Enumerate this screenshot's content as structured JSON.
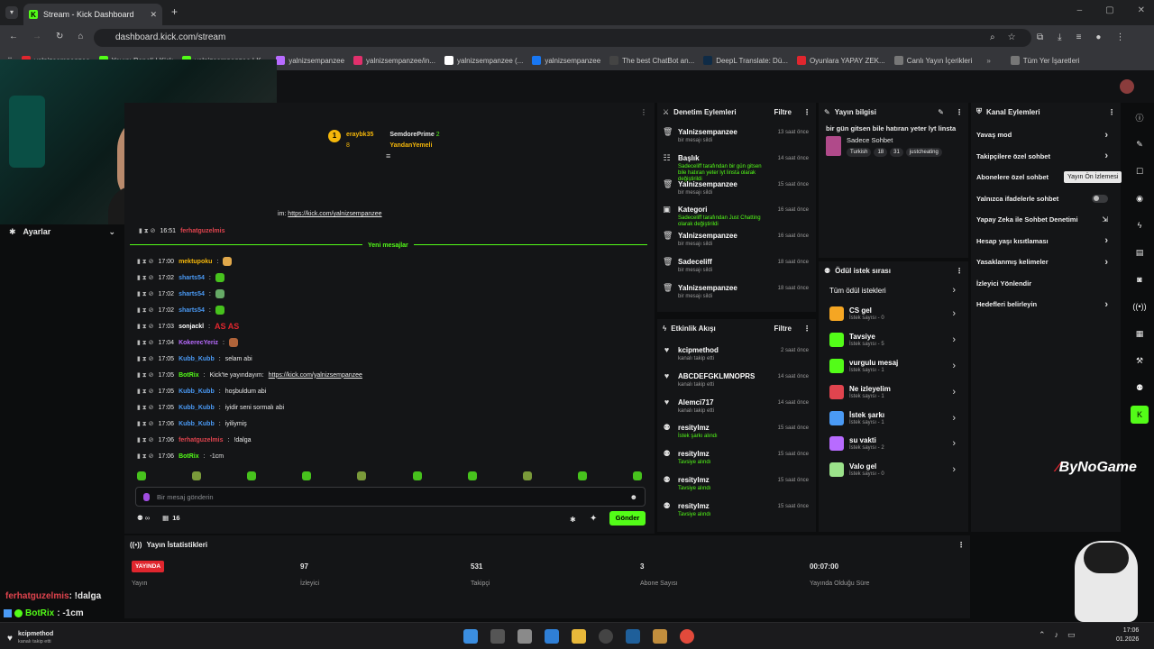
{
  "browser": {
    "tab_title": "Stream - Kick Dashboard",
    "url": "dashboard.kick.com/stream",
    "bookmarks": [
      "yalnizsempanzee",
      "Yayın: Popeli | Kick",
      "yalnizsempanzee | K...",
      "yalnizsempanzee",
      "yalnizsempanzee/in...",
      "yalnizsempanzee (...",
      "yalnizsempanzee",
      "The best ChatBot an...",
      "DeepL Translate: Dü...",
      "Oyunlara YAPAY ZEK...",
      "Canlı Yayın İçerikleri"
    ],
    "all_bookmarks": "Tüm Yer İşaretleri"
  },
  "settings_label": "Ayarlar",
  "chat": {
    "pinned_user1": "eraybk35",
    "pinned_user2": "SemdorePrime",
    "pinned_user3": "YandanYemeli",
    "pinned_count1": "8",
    "pinned_count2": "2",
    "top_link_prefix": "im:",
    "top_link": "https://kick.com/yalnizsempanzee",
    "first_line_time": "16:51",
    "first_line_user": "ferhatguzelmis",
    "new_messages": "Yeni mesajlar",
    "lines": [
      {
        "time": "17:00",
        "user": "mektupoku",
        "color": "#f5b70a",
        "text": ""
      },
      {
        "time": "17:02",
        "user": "sharts54",
        "color": "#4a9af5",
        "text": ""
      },
      {
        "time": "17:02",
        "user": "sharts54",
        "color": "#4a9af5",
        "text": ""
      },
      {
        "time": "17:02",
        "user": "sharts54",
        "color": "#4a9af5",
        "text": ""
      },
      {
        "time": "17:03",
        "user": "sonjackl",
        "color": "#ffffff",
        "text": "AS AS"
      },
      {
        "time": "17:04",
        "user": "KokerecYeriz",
        "color": "#b86bff",
        "text": ""
      },
      {
        "time": "17:05",
        "user": "Kubb_Kubb",
        "color": "#4a9af5",
        "text": "selam abi"
      },
      {
        "time": "17:05",
        "user": "BotRix",
        "color": "#53fc18",
        "text": "Kick'te yayındayım: ",
        "link": "https://kick.com/yalnizsempanzee"
      },
      {
        "time": "17:05",
        "user": "Kubb_Kubb",
        "color": "#4a9af5",
        "text": "hoşbuldum abi"
      },
      {
        "time": "17:05",
        "user": "Kubb_Kubb",
        "color": "#4a9af5",
        "text": "iyidir seni sormalı abi"
      },
      {
        "time": "17:06",
        "user": "Kubb_Kubb",
        "color": "#4a9af5",
        "text": "iyiliymiş"
      },
      {
        "time": "17:06",
        "user": "ferhatguzelmis",
        "color": "#e0444e",
        "text": "!dalga"
      },
      {
        "time": "17:06",
        "user": "BotRix",
        "color": "#53fc18",
        "text": "-1cm"
      }
    ],
    "input_placeholder": "Bir mesaj gönderin",
    "viewer_count": "16",
    "send": "Gönder"
  },
  "moderation": {
    "title": "Denetim Eylemleri",
    "filter": "Filtre",
    "items": [
      {
        "name": "Yalnizsempanzee",
        "sub": "bir mesajı sildi",
        "time": "13 saat önce",
        "icon": "trash-icon"
      },
      {
        "name": "Başlık",
        "sub": "Sadeceliff tarafından bir gün gitsen bile hatıran yeter lyt linsta olarak değiştirildi",
        "time": "14 saat önce",
        "icon": "title-icon"
      },
      {
        "name": "Yalnizsempanzee",
        "sub": "bir mesajı sildi",
        "time": "15 saat önce",
        "icon": "trash-icon"
      },
      {
        "name": "Kategori",
        "sub": "Sadeceliff tarafından Just Chatting olarak değiştirildi",
        "time": "16 saat önce",
        "icon": "category-icon"
      },
      {
        "name": "Yalnizsempanzee",
        "sub": "bir mesajı sildi",
        "time": "16 saat önce",
        "icon": "trash-icon"
      },
      {
        "name": "Sadeceliff",
        "sub": "bir mesajı sildi",
        "time": "18 saat önce",
        "icon": "trash-icon"
      },
      {
        "name": "Yalnizsempanzee",
        "sub": "bir mesajı sildi",
        "time": "18 saat önce",
        "icon": "trash-icon"
      }
    ]
  },
  "activity": {
    "title": "Etkinlik Akışı",
    "filter": "Filtre",
    "items": [
      {
        "name": "kcipmethod",
        "sub": "kanalı takip etti",
        "time": "2 saat önce",
        "icon": "heart-icon"
      },
      {
        "name": "ABCDEFGKLMNOPRS",
        "sub": "kanalı takip etti",
        "time": "14 saat önce",
        "icon": "heart-icon"
      },
      {
        "name": "Alemci717",
        "sub": "kanalı takip etti",
        "time": "14 saat önce",
        "icon": "heart-icon"
      },
      {
        "name": "resitylmz",
        "sub": "İstek şarkı alındı",
        "time": "15 saat önce",
        "icon": "reward-icon"
      },
      {
        "name": "resitylmz",
        "sub": "Tavsiye alındı",
        "time": "15 saat önce",
        "icon": "reward-icon"
      },
      {
        "name": "resitylmz",
        "sub": "Tavsiye alındı",
        "time": "15 saat önce",
        "icon": "reward-icon"
      },
      {
        "name": "resitylmz",
        "sub": "Tavsiye alındı",
        "time": "15 saat önce",
        "icon": "reward-icon"
      }
    ]
  },
  "stream_info": {
    "title_label": "Yayın bilgisi",
    "stream_title": "bir gün gitsen bile hatıran yeter lyt linsta",
    "category": "Sadece Sohbet",
    "tags": [
      "Turkish",
      "18",
      "31",
      "justcheating"
    ]
  },
  "rewards": {
    "title": "Ödül istek sırası",
    "all": "Tüm ödül istekleri",
    "items": [
      {
        "name": "CS gel",
        "sub": "İstek sayısı - 0",
        "color": "#f5a623"
      },
      {
        "name": "Tavsiye",
        "sub": "İstek sayısı - 5",
        "color": "#53fc18"
      },
      {
        "name": "vurgulu mesaj",
        "sub": "İstek sayısı - 1",
        "color": "#53fc18"
      },
      {
        "name": "Ne izleyelim",
        "sub": "İstek sayısı - 1",
        "color": "#e0444e"
      },
      {
        "name": "İstek şarkı",
        "sub": "İstek sayısı - 1",
        "color": "#4a9af5"
      },
      {
        "name": "su vakti",
        "sub": "İstek sayısı - 2",
        "color": "#b86bff"
      },
      {
        "name": "Valo gel",
        "sub": "İstek sayısı - 0",
        "color": "#9be28a"
      }
    ]
  },
  "channel_actions": {
    "title": "Kanal Eylemleri",
    "items": [
      "Yavaş mod",
      "Takipçilere özel sohbet",
      "Abonelere özel sohbet",
      "Yalnızca ifadelerle sohbet",
      "Yapay Zeka ile Sohbet Denetimi",
      "Hesap yaşı kısıtlaması",
      "Yasaklanmış kelimeler",
      "İzleyici Yönlendir",
      "Hedefleri belirleyin"
    ],
    "tooltip": "Yayın Ön İzlemesi"
  },
  "stats": {
    "title": "Yayın İstatistikleri",
    "live_badge": "YAYINDA",
    "live_label": "Yayın",
    "viewers": "97",
    "viewers_label": "İzleyici",
    "followers": "531",
    "followers_label": "Takipçi",
    "subs": "3",
    "subs_label": "Abone Sayısı",
    "uptime": "00:07:00",
    "uptime_label": "Yayında Olduğu Süre"
  },
  "overlay": {
    "chat1_user": "ferhatguzelmis",
    "chat1_text": ": !dalga",
    "chat2_user": "BotRix",
    "chat2_text": ": -1cm",
    "follow_name": "kcipmethod",
    "follow_sub": "kanalı takip etti",
    "watermark": "ByNoGame"
  },
  "taskbar": {
    "time": "17:06",
    "date": "01.2026"
  }
}
